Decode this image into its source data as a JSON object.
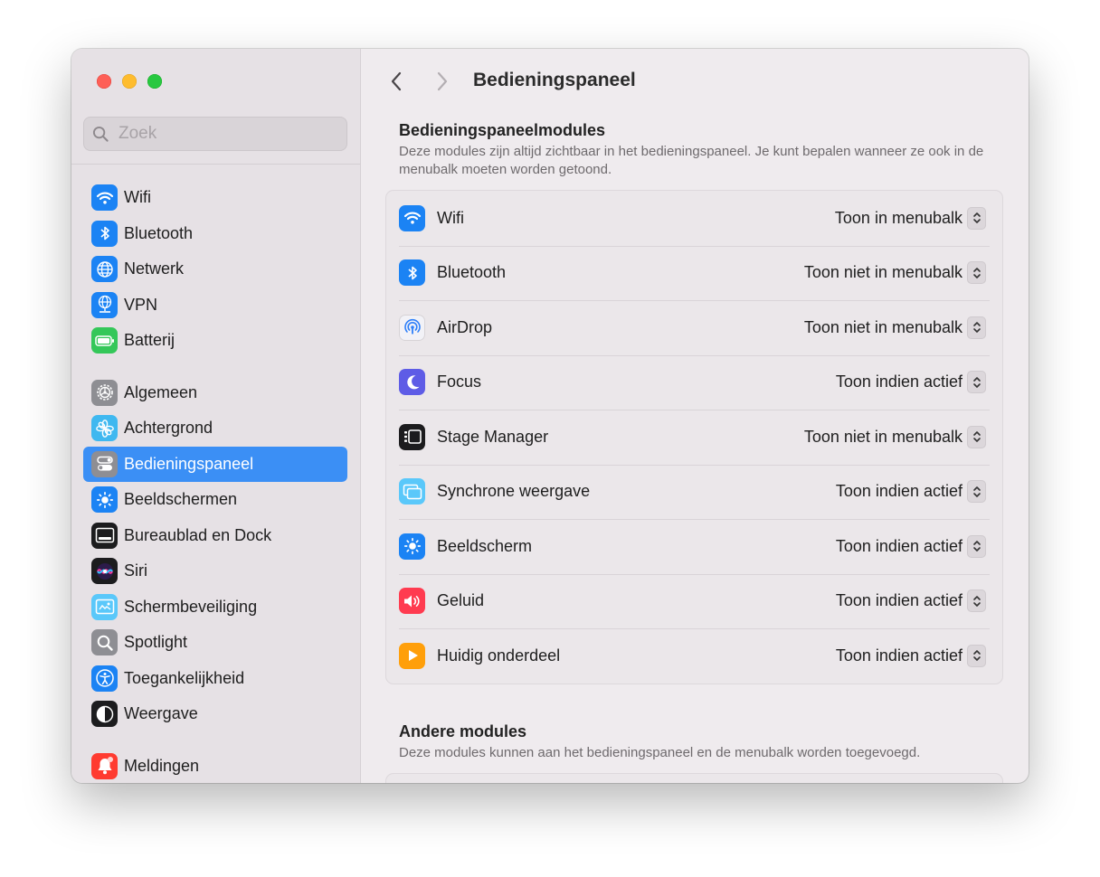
{
  "sidebar": {
    "search_placeholder": "Zoek",
    "groups": [
      [
        {
          "label": "Wifi",
          "icon": "wifi-icon",
          "color": "#1b83f4"
        },
        {
          "label": "Bluetooth",
          "icon": "bluetooth-icon",
          "color": "#1b83f4"
        },
        {
          "label": "Netwerk",
          "icon": "globe-icon",
          "color": "#1b83f4"
        },
        {
          "label": "VPN",
          "icon": "vpn-globe-icon",
          "color": "#1b83f4"
        },
        {
          "label": "Batterij",
          "icon": "battery-icon",
          "color": "#34c759"
        }
      ],
      [
        {
          "label": "Algemeen",
          "icon": "gear-icon",
          "color": "#8e8e93"
        },
        {
          "label": "Achtergrond",
          "icon": "flower-icon",
          "color": "#3fb8f0"
        },
        {
          "label": "Bedieningspaneel",
          "icon": "toggles-icon",
          "color": "#8e8e93",
          "active": true
        },
        {
          "label": "Beeldschermen",
          "icon": "sun-icon",
          "color": "#1b83f4"
        },
        {
          "label": "Bureaublad en Dock",
          "icon": "dock-icon",
          "color": "#1c1c1e"
        },
        {
          "label": "Siri",
          "icon": "siri-icon",
          "color": "#1c1c1e"
        },
        {
          "label": "Schermbeveiliging",
          "icon": "screensaver-icon",
          "color": "#5ac8fa"
        },
        {
          "label": "Spotlight",
          "icon": "magnifier-icon",
          "color": "#8e8e93"
        },
        {
          "label": "Toegankelijkheid",
          "icon": "accessibility-icon",
          "color": "#1b83f4"
        },
        {
          "label": "Weergave",
          "icon": "appearance-icon",
          "color": "#1c1c1e"
        }
      ],
      [
        {
          "label": "Meldingen",
          "icon": "bell-icon",
          "color": "#ff3b30"
        }
      ]
    ]
  },
  "main": {
    "title": "Bedieningspaneel",
    "sections": [
      {
        "title": "Bedieningspaneelmodules",
        "description": "Deze modules zijn altijd zichtbaar in het bedieningspaneel. Je kunt bepalen wanneer ze ook in de menubalk moeten worden getoond.",
        "modules": [
          {
            "label": "Wifi",
            "icon": "wifi-icon",
            "color": "#1b83f4",
            "value": "Toon in menubalk"
          },
          {
            "label": "Bluetooth",
            "icon": "bluetooth-icon",
            "color": "#1b83f4",
            "value": "Toon niet in menubalk"
          },
          {
            "label": "AirDrop",
            "icon": "airdrop-icon",
            "color": "#f2f2f7",
            "value": "Toon niet in menubalk"
          },
          {
            "label": "Focus",
            "icon": "moon-icon",
            "color": "#5e5ce6",
            "value": "Toon indien actief"
          },
          {
            "label": "Stage Manager",
            "icon": "stage-manager-icon",
            "color": "#1c1c1e",
            "value": "Toon niet in menubalk"
          },
          {
            "label": "Synchrone weergave",
            "icon": "screen-mirroring-icon",
            "color": "#5ac8fa",
            "value": "Toon indien actief"
          },
          {
            "label": "Beeldscherm",
            "icon": "sun-icon",
            "color": "#1b83f4",
            "value": "Toon indien actief"
          },
          {
            "label": "Geluid",
            "icon": "speaker-icon",
            "color": "#ff3b50",
            "value": "Toon indien actief"
          },
          {
            "label": "Huidig onderdeel",
            "icon": "play-icon",
            "color": "#ff9f0a",
            "value": "Toon indien actief"
          }
        ]
      },
      {
        "title": "Andere modules",
        "description": "Deze modules kunnen aan het bedieningspaneel en de menubalk worden toegevoegd."
      }
    ]
  }
}
